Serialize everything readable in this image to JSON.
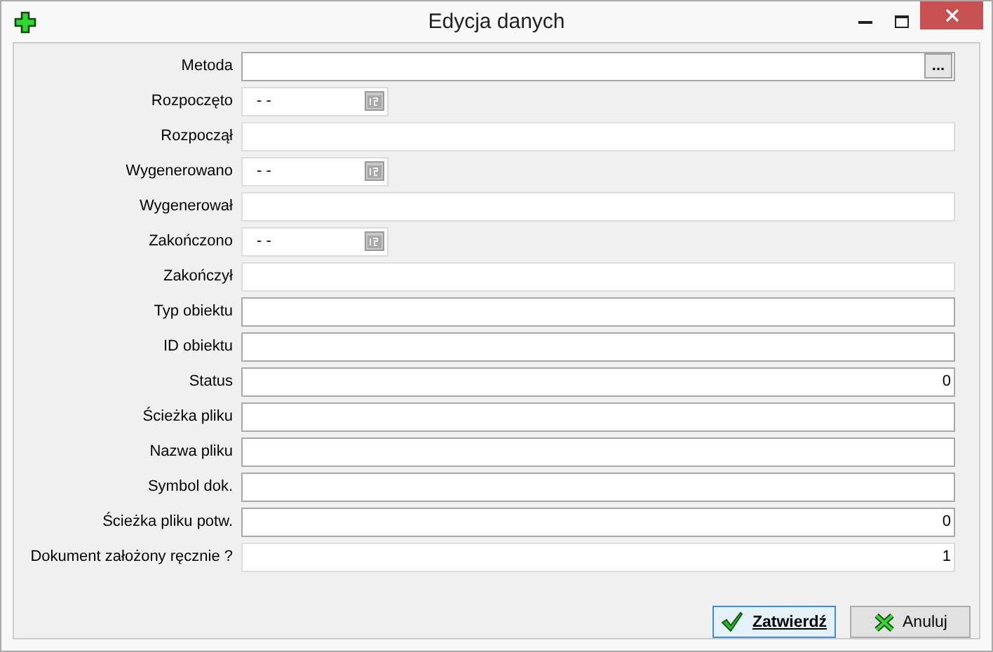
{
  "window": {
    "title": "Edycja danych"
  },
  "fields": [
    {
      "label": "Metoda",
      "kind": "lookup",
      "disabled": false,
      "button": "..."
    },
    {
      "label": "Rozpoczęto",
      "kind": "date",
      "value": "- -",
      "disabled": true
    },
    {
      "label": "Rozpoczął",
      "kind": "text",
      "disabled": true
    },
    {
      "label": "Wygenerowano",
      "kind": "date",
      "value": "- -",
      "disabled": true
    },
    {
      "label": "Wygenerował",
      "kind": "text",
      "disabled": true
    },
    {
      "label": "Zakończono",
      "kind": "date",
      "value": "- -",
      "disabled": true
    },
    {
      "label": "Zakończył",
      "kind": "text",
      "disabled": true
    },
    {
      "label": "Typ obiektu",
      "kind": "text",
      "disabled": false
    },
    {
      "label": "ID obiektu",
      "kind": "text",
      "disabled": false
    },
    {
      "label": "Status",
      "kind": "number",
      "value": "0",
      "disabled": false
    },
    {
      "label": "Ścieżka pliku",
      "kind": "text",
      "disabled": false
    },
    {
      "label": "Nazwa pliku",
      "kind": "text",
      "disabled": false
    },
    {
      "label": "Symbol dok.",
      "kind": "text",
      "disabled": false
    },
    {
      "label": "Ścieżka pliku potw.",
      "kind": "number",
      "value": "0",
      "disabled": false
    },
    {
      "label": "Dokument założony ręcznie ?",
      "kind": "number",
      "value": "1",
      "disabled": true
    }
  ],
  "buttons": [
    {
      "label": "Zatwierdź",
      "kind": "ok",
      "default": true
    },
    {
      "label": "Anuluj",
      "kind": "cancel",
      "default": false
    }
  ]
}
